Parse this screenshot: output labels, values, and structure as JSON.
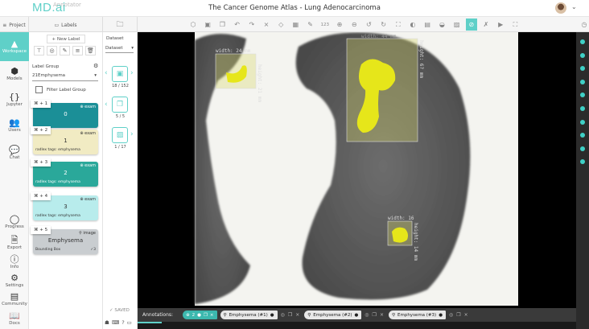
{
  "header": {
    "logo": "MD.ai",
    "logo_sub": "Annotator",
    "title": "The Cancer Genome Atlas - Lung Adenocarcinoma",
    "user_menu_icon": "chevron-down-icon"
  },
  "toolbar": {
    "project": "Project",
    "labels": "Labels",
    "tools": [
      "cube-icon",
      "image-add-icon",
      "copy-icon",
      "undo-icon",
      "redo-icon",
      "brush-off-icon",
      "eraser-icon",
      "grid-icon",
      "pencil-icon",
      "123",
      "zoom-in-icon",
      "zoom-out-icon",
      "rotate-left-icon",
      "rotate-right-icon",
      "fit-icon",
      "contrast-icon",
      "window-icon",
      "lung-icon",
      "image-icon",
      "hide-annotations-icon",
      "marker-off-icon",
      "play-icon",
      "fullscreen-icon",
      "history-icon"
    ],
    "numbers_tool": "123"
  },
  "nav": [
    {
      "label": "Workspace",
      "active": true
    },
    {
      "label": "Models"
    },
    {
      "label": "Jupyter"
    },
    {
      "label": "Users"
    },
    {
      "label": "Chat"
    },
    {
      "label": "Progress"
    },
    {
      "label": "Export"
    },
    {
      "label": "Info"
    },
    {
      "label": "Settings"
    },
    {
      "label": "Community"
    },
    {
      "label": "Docs"
    }
  ],
  "labels": {
    "new_label": "+ New Label",
    "group_title": "Label Group",
    "group_value": "21Emphysema",
    "filter": "Filter Label Group",
    "cards": [
      {
        "key": "⌘ + 1",
        "scope": "exam",
        "name": "0",
        "tag": "",
        "color": "#1b8f97"
      },
      {
        "key": "⌘ + 2",
        "scope": "exam",
        "name": "1",
        "tag": "radlex tags: emphysema",
        "color": "#f1ebc3"
      },
      {
        "key": "⌘ + 3",
        "scope": "exam",
        "name": "2",
        "tag": "radlex tags: emphysema",
        "color": "#2aa89a"
      },
      {
        "key": "⌘ + 4",
        "scope": "exam",
        "name": "3",
        "tag": "radlex tags: emphysema",
        "color": "#b8ecec"
      },
      {
        "key": "⌘ + 5",
        "scope": "image",
        "name": "Emphysema",
        "tag": "Bounding Box",
        "count": "✓3",
        "color": "#c9cdd0"
      }
    ]
  },
  "dataset": {
    "title": "Dataset",
    "select": "Dataset",
    "studies": "18 / 152",
    "series": "5 / 5",
    "images": "1 / 17",
    "saved": "✓ SAVED"
  },
  "viewer": {
    "measures": [
      "width: 24 mm",
      "height: 21 mm",
      "width: 44 mm",
      "height: 6? mm",
      "width: 16",
      "height: 14 mm"
    ]
  },
  "annotations": {
    "label": "Annotations:",
    "group_count": "2",
    "items": [
      "Emphysema (#1)",
      "Emphysema (#2)",
      "Emphysema (#3)"
    ]
  },
  "colors": {
    "accent": "#5fd0c8",
    "overlay": "#e6e61a"
  }
}
